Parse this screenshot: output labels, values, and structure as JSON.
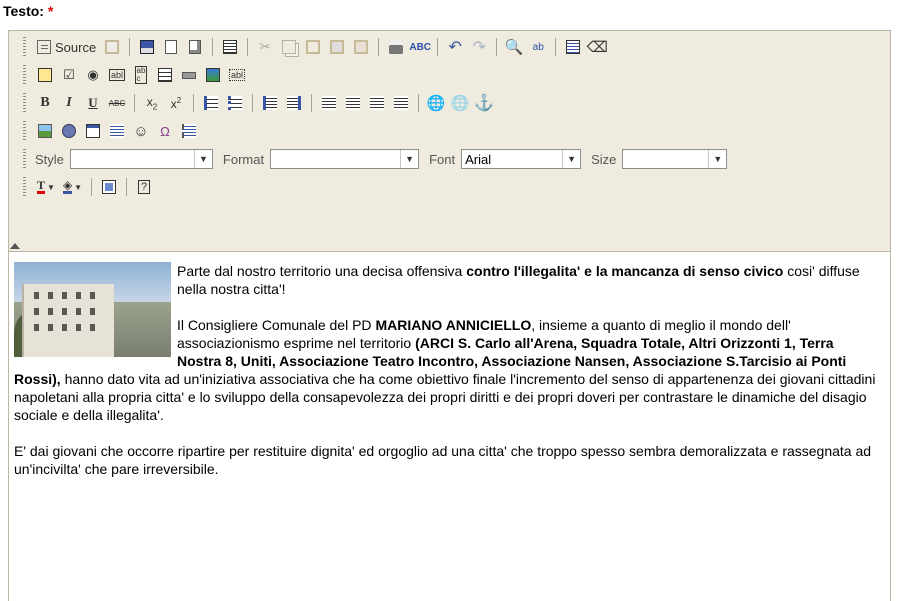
{
  "field": {
    "label": "Testo:",
    "required_mark": "*"
  },
  "toolbar": {
    "source_label": "Source",
    "style_label": "Style",
    "format_label": "Format",
    "font_label": "Font",
    "font_value": "Arial",
    "size_label": "Size",
    "style_value": "",
    "format_value": "",
    "size_value": ""
  },
  "content": {
    "p1": {
      "a": "Parte dal nostro territorio una decisa offensiva ",
      "b": "contro l'illegalita' e la mancanza di senso civico",
      "c": " cosi' diffuse nella nostra citta'!"
    },
    "p2": {
      "a": "Il Consigliere Comunale del PD ",
      "b": "MARIANO ANNICIELLO",
      "c": ", insieme a quanto di meglio il mondo dell' associazionismo esprime nel territorio ",
      "d": "(ARCI S. Carlo all'Arena, Squadra Totale, Altri Orizzonti 1, Terra Nostra 8, Uniti, Associazione Teatro Incontro, Associazione Nansen, Associazione S.Tarcisio ai Ponti Rossi),",
      "e": " hanno dato vita ad un'iniziativa associativa che ha come obiettivo finale l'incremento del senso di appartenenza dei giovani cittadini napoletani alla propria citta' e lo sviluppo della consapevolezza dei propri diritti e dei propri doveri per contrastare le dinamiche del disagio sociale e della illegalita'."
    },
    "p3": "E' dai giovani che occorre ripartire per restituire dignita' ed orgoglio ad una citta' che troppo spesso sembra demoralizzata e rassegnata ad un'incivilta' che pare irreversibile."
  },
  "icons": [
    "source-icon",
    "paste-icon",
    "save-icon",
    "new-page-icon",
    "preview-icon",
    "templates-icon",
    "cut-icon",
    "copy-icon",
    "paste-text-icon",
    "paste-word-icon",
    "print-icon",
    "spellcheck-icon",
    "undo-icon",
    "redo-icon",
    "find-icon",
    "replace-icon",
    "select-all-icon",
    "remove-format-icon",
    "form-icon",
    "checkbox-icon",
    "radio-icon",
    "textfield-icon",
    "textarea-icon",
    "select-icon",
    "button-icon",
    "image-button-icon",
    "hidden-field-icon",
    "bold-icon",
    "italic-icon",
    "underline-icon",
    "strike-icon",
    "subscript-icon",
    "superscript-icon",
    "numbered-list-icon",
    "bulleted-list-icon",
    "outdent-icon",
    "indent-icon",
    "align-left-icon",
    "align-center-icon",
    "align-right-icon",
    "justify-icon",
    "link-icon",
    "unlink-icon",
    "anchor-icon",
    "image-icon",
    "flash-icon",
    "table-icon",
    "horizontal-rule-icon",
    "smiley-icon",
    "special-char-icon",
    "page-break-icon",
    "text-color-icon",
    "bg-color-icon",
    "maximize-icon",
    "about-icon"
  ]
}
